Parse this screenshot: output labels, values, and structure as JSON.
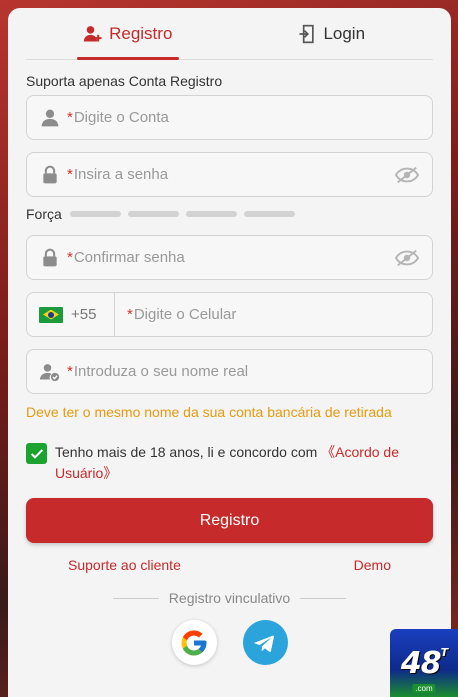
{
  "tabs": [
    {
      "label": "Registro",
      "icon": "user-plus-icon",
      "active": true
    },
    {
      "label": "Login",
      "icon": "login-door-icon",
      "active": false
    }
  ],
  "hint": "Suporta apenas Conta Registro",
  "fields": {
    "account": {
      "required_mark": "*",
      "placeholder": "Digite o Conta",
      "value": ""
    },
    "password": {
      "required_mark": "*",
      "placeholder": "Insira a senha",
      "value": ""
    },
    "confirm": {
      "required_mark": "*",
      "placeholder": "Confirmar senha",
      "value": ""
    },
    "phone": {
      "country_code": "+55",
      "required_mark": "*",
      "placeholder": "Digite o Celular",
      "value": ""
    },
    "realname": {
      "required_mark": "*",
      "placeholder": "Introduza o seu nome real",
      "value": ""
    }
  },
  "strength": {
    "label": "Força",
    "level": 0,
    "segments": 4
  },
  "warning": "Deve ter o mesmo nome da sua conta bancária de retirada",
  "agree": {
    "checked": true,
    "text": "Tenho mais de 18 anos, li e concordo com ",
    "link": "《Acordo de Usuário》"
  },
  "submit_label": "Registro",
  "links": {
    "support": "Suporte ao cliente",
    "demo": "Demo"
  },
  "divider_label": "Registro vinculativo",
  "socials": [
    {
      "name": "google-icon"
    },
    {
      "name": "telegram-icon"
    }
  ],
  "logo": {
    "text": "48",
    "sup": "T",
    "domain": ".com"
  },
  "colors": {
    "accent": "#c62a2a",
    "warning": "#e69a10",
    "checkbox": "#1aa32f",
    "telegram": "#2ba3db"
  }
}
